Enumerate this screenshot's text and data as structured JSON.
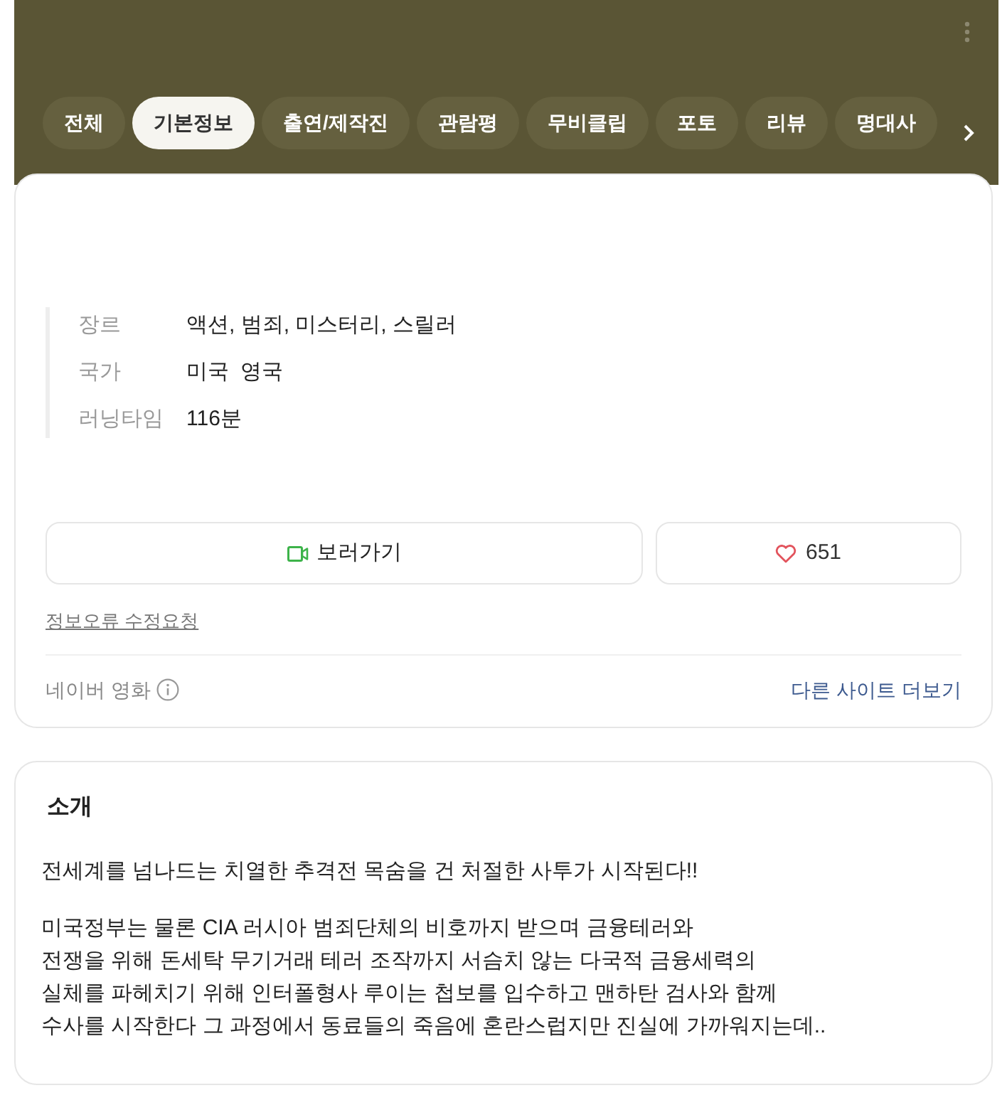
{
  "header": {
    "tabs": [
      {
        "label": "전체",
        "selected": false
      },
      {
        "label": "기본정보",
        "selected": true
      },
      {
        "label": "출연/제작진",
        "selected": false
      },
      {
        "label": "관람평",
        "selected": false
      },
      {
        "label": "무비클립",
        "selected": false
      },
      {
        "label": "포토",
        "selected": false
      },
      {
        "label": "리뷰",
        "selected": false
      },
      {
        "label": "명대사",
        "selected": false
      }
    ]
  },
  "info_card": {
    "fields": [
      {
        "label": "장르",
        "values": [
          "액션, 범죄, 미스터리, 스릴러"
        ]
      },
      {
        "label": "국가",
        "values": [
          "미국",
          "영국"
        ]
      },
      {
        "label": "러닝타임",
        "values": [
          "116분"
        ]
      }
    ],
    "watch_button": {
      "label": "보러가기"
    },
    "like_button": {
      "count": "651"
    },
    "report_link": "정보오류 수정요청",
    "source": {
      "label": "네이버 영화"
    },
    "more_sites_link": "다른 사이트 더보기"
  },
  "synopsis": {
    "title": "소개",
    "paragraphs": [
      "전세계를 넘나드는 치열한 추격전 목숨을 건 처절한 사투가 시작된다!!",
      "미국정부는 물론 CIA 러시아 범죄단체의 비호까지 받으며 금융테러와\n전쟁을 위해 돈세탁 무기거래 테러 조작까지 서슴치 않는 다국적 금융세력의\n실체를 파헤치기 위해 인터폴형사 루이는 첩보를 입수하고 맨하탄 검사와 함께\n수사를 시작한다 그 과정에서 동료들의 죽음에 혼란스럽지만 진실에 가까워지는데.."
    ]
  }
}
